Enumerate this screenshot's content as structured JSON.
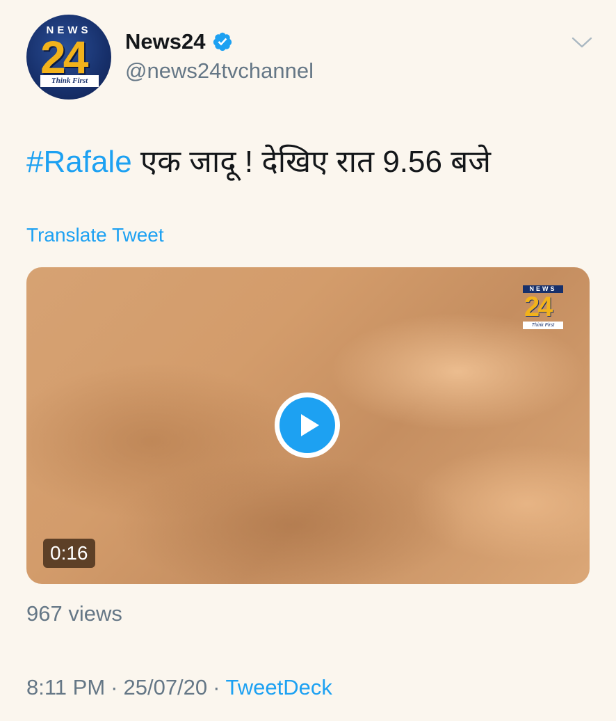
{
  "account": {
    "display_name": "News24",
    "handle": "@news24tvchannel",
    "verified": true,
    "avatar": {
      "top_text": "NEWS",
      "number": "24",
      "tagline": "Think First"
    }
  },
  "icons": {
    "verified": "verified-badge-icon",
    "more": "chevron-down-icon",
    "play": "play-icon"
  },
  "tweet": {
    "hashtag": "#Rafale",
    "text": " एक जादू ! देखिए रात 9.56 बजे",
    "translate_label": "Translate Tweet"
  },
  "media": {
    "duration": "0:16",
    "watermark": {
      "top_text": "NEWS",
      "number": "24",
      "tagline": "Think First"
    }
  },
  "stats": {
    "views": "967 views"
  },
  "meta": {
    "time": "8:11 PM",
    "separator": "·",
    "date": "25/07/20",
    "source": "TweetDeck"
  },
  "colors": {
    "background": "#fbf6ee",
    "accent": "#1da1f2",
    "secondary_text": "#657786",
    "primary_text": "#14171a"
  }
}
